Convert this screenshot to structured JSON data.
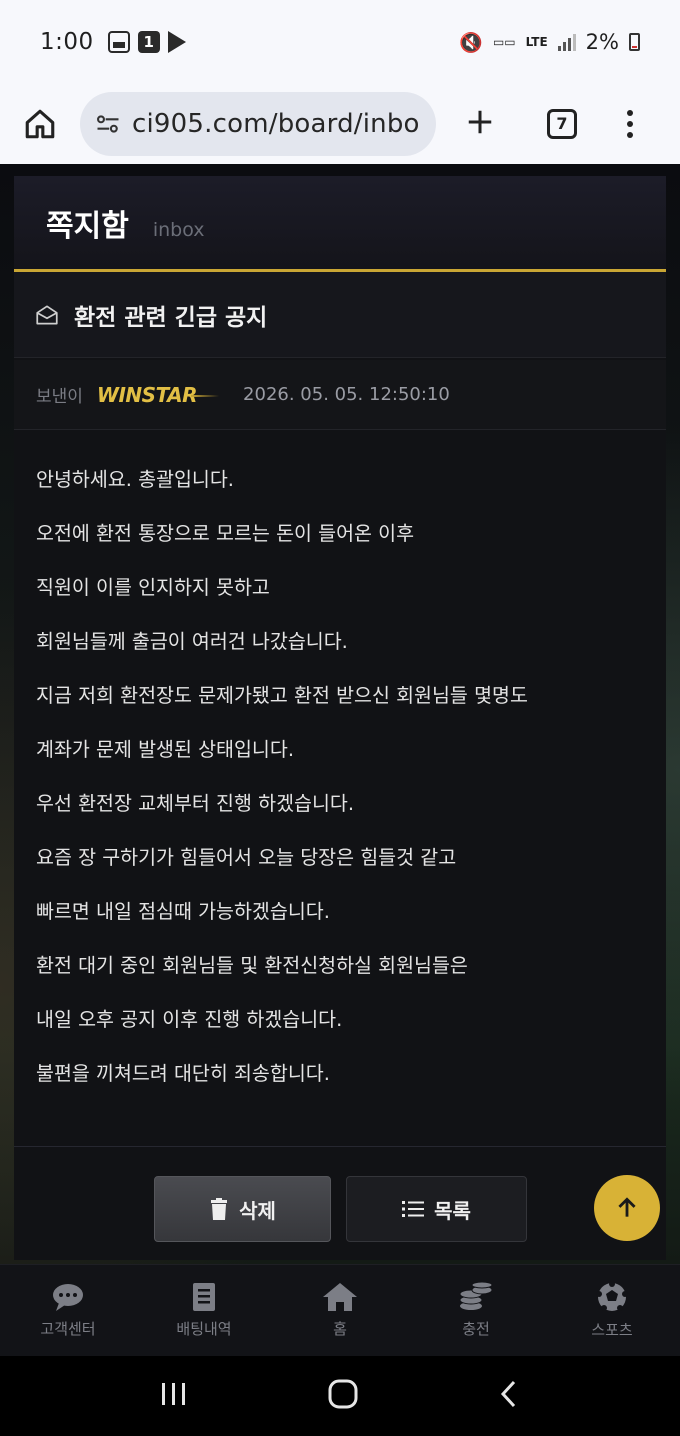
{
  "status_bar": {
    "time": "1:00",
    "battery": "2%",
    "network": "LTE"
  },
  "browser": {
    "url": "ci905.com/board/inbo",
    "tab_count": "7"
  },
  "card": {
    "title": "쪽지함",
    "subtitle": "inbox",
    "subject": "환전 관련 긴급 공지",
    "sender_label": "보낸이",
    "sender_logo": "WINSTAR",
    "date": "2026. 05. 05. 12:50:10",
    "body": [
      "안녕하세요. 총괄입니다.",
      "오전에 환전 통장으로 모르는 돈이 들어온 이후",
      "직원이 이를 인지하지 못하고",
      "회원님들께 출금이 여러건 나갔습니다.",
      "지금 저희 환전장도 문제가됐고 환전 받으신 회원님들 몇명도",
      "계좌가 문제 발생된 상태입니다.",
      "우선 환전장 교체부터 진행 하겠습니다.",
      "요즘 장 구하기가 힘들어서 오늘 당장은 힘들것 같고",
      "빠르면 내일 점심때 가능하겠습니다.",
      "환전 대기 중인 회원님들 및 환전신청하실 회원님들은",
      "내일 오후 공지 이후 진행 하겠습니다.",
      "불편을 끼쳐드려 대단히 죄송합니다."
    ],
    "delete_label": "삭제",
    "list_label": "목록"
  },
  "bottom_nav": [
    {
      "label": "고객센터",
      "icon": "chat-icon"
    },
    {
      "label": "배팅내역",
      "icon": "receipt-icon"
    },
    {
      "label": "홈",
      "icon": "home-icon"
    },
    {
      "label": "충전",
      "icon": "coins-icon"
    },
    {
      "label": "스포츠",
      "icon": "soccer-ball-icon"
    }
  ],
  "colors": {
    "accent_gold": "#d8b236",
    "card_bg": "#111215",
    "nav_bg": "#121317"
  }
}
